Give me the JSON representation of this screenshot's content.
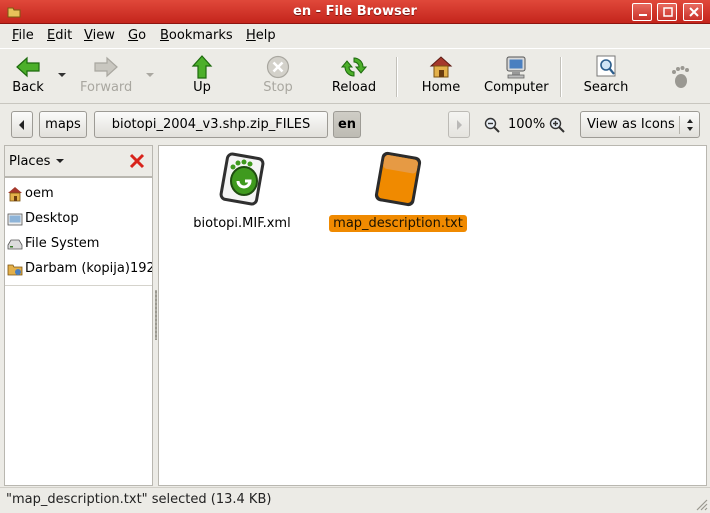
{
  "window": {
    "title": "en - File Browser"
  },
  "menu": [
    {
      "label": "File",
      "mnemonic": "F",
      "rest": "ile"
    },
    {
      "label": "Edit",
      "mnemonic": "E",
      "rest": "dit"
    },
    {
      "label": "View",
      "mnemonic": "V",
      "rest": "iew"
    },
    {
      "label": "Go",
      "mnemonic": "G",
      "rest": "o"
    },
    {
      "label": "Bookmarks",
      "mnemonic": "B",
      "rest": "ookmarks"
    },
    {
      "label": "Help",
      "mnemonic": "H",
      "rest": "elp"
    }
  ],
  "toolbar": {
    "back": "Back",
    "forward": "Forward",
    "up": "Up",
    "stop": "Stop",
    "reload": "Reload",
    "home": "Home",
    "computer": "Computer",
    "search": "Search"
  },
  "location": {
    "path": [
      "maps",
      "biotopi_2004_v3.shp.zip_FILES",
      "en"
    ],
    "active": "en",
    "zoom": "100%",
    "view_mode": "View as Icons"
  },
  "sidebar": {
    "header": "Places",
    "items": [
      {
        "label": "oem",
        "icon": "home-folder-icon"
      },
      {
        "label": "Desktop",
        "icon": "desktop-folder-icon"
      },
      {
        "label": "File System",
        "icon": "drive-icon"
      },
      {
        "label": "Darbam (kopija)192",
        "icon": "network-folder-icon"
      }
    ]
  },
  "files": [
    {
      "name": "biotopi.MIF.xml",
      "icon": "gnome-xml-file-icon",
      "selected": false
    },
    {
      "name": "map_description.txt",
      "icon": "text-file-icon",
      "selected": true
    }
  ],
  "status": {
    "text": "\"map_description.txt\" selected (13.4 KB)"
  },
  "colors": {
    "titlebar": "#d5372c",
    "selection": "#f08a00"
  }
}
